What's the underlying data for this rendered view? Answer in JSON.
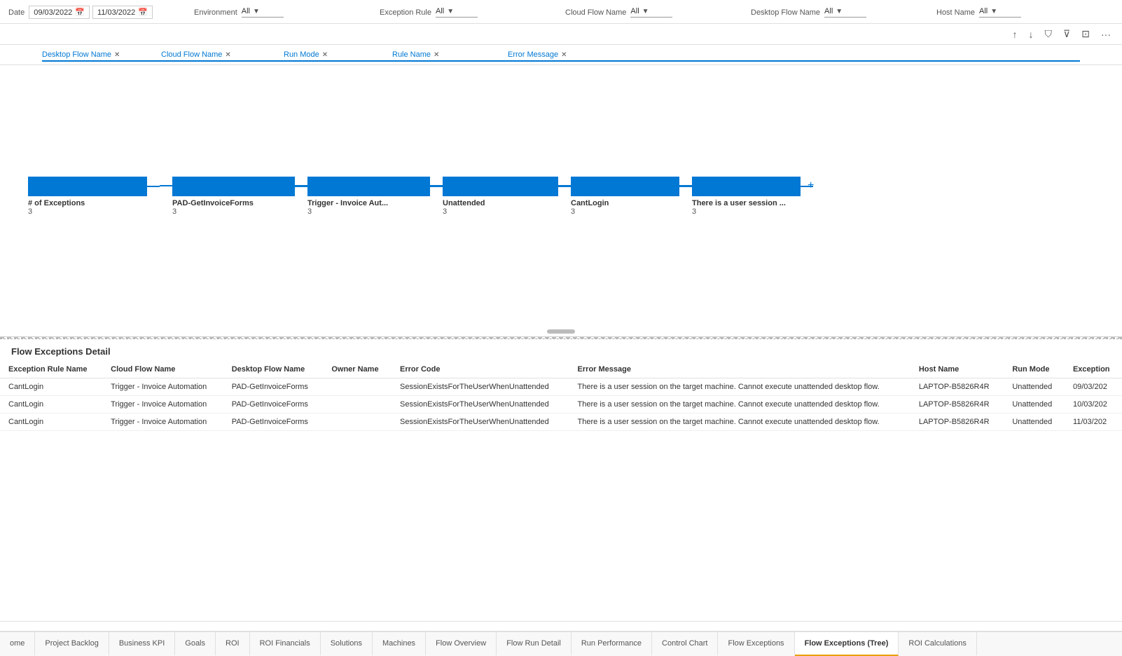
{
  "filters": {
    "date_label": "Date",
    "date_start": "09/03/2022",
    "date_end": "11/03/2022",
    "environment_label": "Environment",
    "environment_value": "All",
    "exception_rule_label": "Exception Rule",
    "exception_rule_value": "All",
    "cloud_flow_label": "Cloud Flow Name",
    "cloud_flow_value": "All",
    "desktop_flow_label": "Desktop Flow Name",
    "desktop_flow_value": "All",
    "host_name_label": "Host Name",
    "host_name_value": "All"
  },
  "toolbar": {
    "sort_asc": "↑",
    "sort_desc": "↓",
    "hierarchy": "⛉",
    "filter": "⊽",
    "export": "⊡",
    "more": "···"
  },
  "decomp": {
    "columns": [
      {
        "label": "Desktop Flow Name",
        "value": "PAD-GetInvoiceForms",
        "count": "3"
      },
      {
        "label": "Cloud Flow Name",
        "value": "Trigger - Invoice Auto...",
        "count": "3"
      },
      {
        "label": "Run Mode",
        "value": "Unattended",
        "count": "3"
      },
      {
        "label": "Rule Name",
        "value": "CantLogin",
        "count": "3"
      },
      {
        "label": "Error Message",
        "value": "There is a user session ...",
        "count": "3"
      }
    ],
    "root_label": "# of Exceptions",
    "root_count": "3"
  },
  "detail": {
    "title": "Flow Exceptions Detail",
    "columns": [
      "Exception Rule Name",
      "Cloud Flow Name",
      "Desktop Flow Name",
      "Owner Name",
      "Error Code",
      "Error Message",
      "Host Name",
      "Run Mode",
      "Exception"
    ],
    "rows": [
      {
        "exception_rule": "CantLogin",
        "cloud_flow": "Trigger - Invoice Automation",
        "desktop_flow": "PAD-GetInvoiceForms",
        "owner": "",
        "error_code": "SessionExistsForTheUserWhenUnattended",
        "error_message": "There is a user session on the target machine. Cannot execute unattended desktop flow.",
        "host_name": "LAPTOP-B5826R4R",
        "run_mode": "Unattended",
        "exception": "09/03/202"
      },
      {
        "exception_rule": "CantLogin",
        "cloud_flow": "Trigger - Invoice Automation",
        "desktop_flow": "PAD-GetInvoiceForms",
        "owner": "",
        "error_code": "SessionExistsForTheUserWhenUnattended",
        "error_message": "There is a user session on the target machine. Cannot execute unattended desktop flow.",
        "host_name": "LAPTOP-B5826R4R",
        "run_mode": "Unattended",
        "exception": "10/03/202"
      },
      {
        "exception_rule": "CantLogin",
        "cloud_flow": "Trigger - Invoice Automation",
        "desktop_flow": "PAD-GetInvoiceForms",
        "owner": "",
        "error_code": "SessionExistsForTheUserWhenUnattended",
        "error_message": "There is a user session on the target machine. Cannot execute unattended desktop flow.",
        "host_name": "LAPTOP-B5826R4R",
        "run_mode": "Unattended",
        "exception": "11/03/202"
      }
    ]
  },
  "tabs": [
    {
      "label": "ome",
      "active": false
    },
    {
      "label": "Project Backlog",
      "active": false
    },
    {
      "label": "Business KPI",
      "active": false
    },
    {
      "label": "Goals",
      "active": false
    },
    {
      "label": "ROI",
      "active": false
    },
    {
      "label": "ROI Financials",
      "active": false
    },
    {
      "label": "Solutions",
      "active": false
    },
    {
      "label": "Machines",
      "active": false
    },
    {
      "label": "Flow Overview",
      "active": false
    },
    {
      "label": "Flow Run Detail",
      "active": false
    },
    {
      "label": "Run Performance",
      "active": false
    },
    {
      "label": "Control Chart",
      "active": false
    },
    {
      "label": "Flow Exceptions",
      "active": false
    },
    {
      "label": "Flow Exceptions (Tree)",
      "active": true
    },
    {
      "label": "ROI Calculations",
      "active": false
    }
  ]
}
